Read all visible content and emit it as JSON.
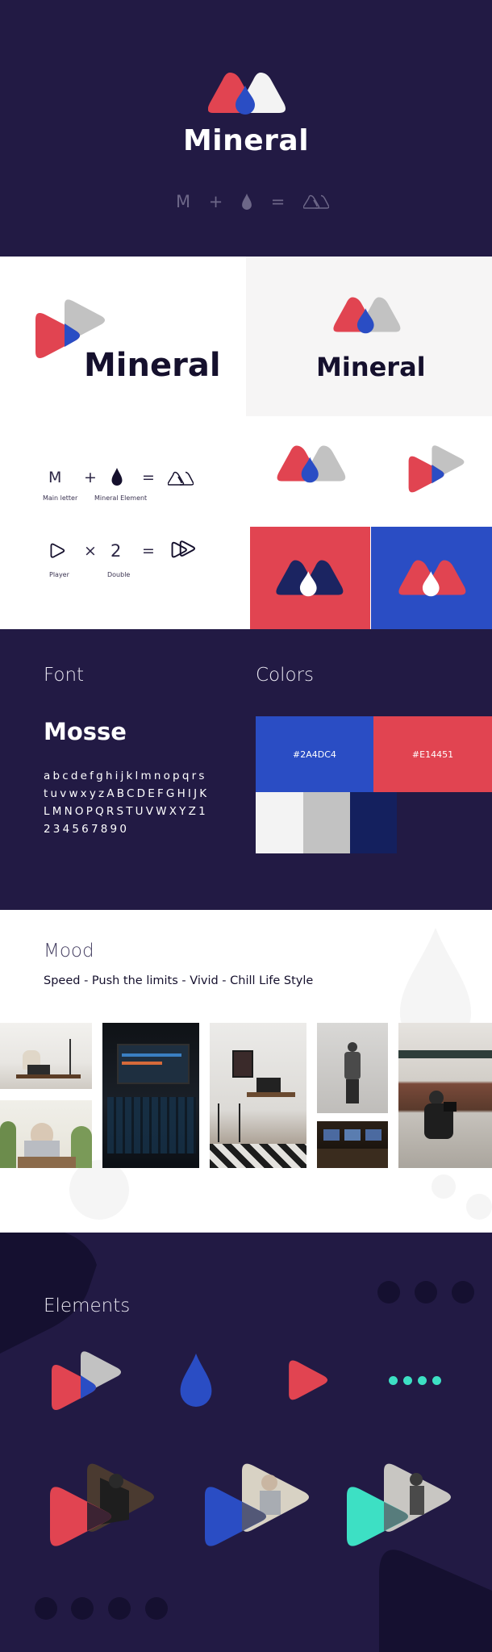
{
  "brand": {
    "name": "Mineral"
  },
  "formula_top": {
    "plus": "+",
    "equals": "=",
    "letter": "M"
  },
  "logo_section": {
    "wordmark": "Mineral",
    "formula1": {
      "letter": "M",
      "plus": "+",
      "equals": "=",
      "label_letter": "Main letter",
      "label_element": "Mineral Element"
    },
    "formula2": {
      "times": "×",
      "number": "2",
      "equals": "=",
      "label_player": "Player",
      "label_double": "Double"
    }
  },
  "font_colors": {
    "font_heading": "Font",
    "colors_heading": "Colors",
    "font_name": "Mosse",
    "alphabet": [
      "abcdefghijklmnopqrs",
      "tuvwxyzABCDEFGHIJK",
      "LMNOPQRSTUVWXYZ1",
      "234567890"
    ],
    "swatches": [
      {
        "hex": "#2A4DC4",
        "color": "#2a4dc4"
      },
      {
        "hex": "#E14451",
        "color": "#e14451"
      }
    ],
    "extra_colors": [
      "#f3f3f3",
      "#c2c2c2",
      "#14205e"
    ]
  },
  "mood": {
    "heading": "Mood",
    "tagline": "Speed - Push the limits - Vivid - Chill Life Style"
  },
  "elements": {
    "heading": "Elements"
  },
  "palette": {
    "red": "#e14451",
    "blue": "#2a4dc4",
    "gray": "#c2c2c2",
    "navy": "#221a44",
    "teal": "#3de0c4"
  }
}
